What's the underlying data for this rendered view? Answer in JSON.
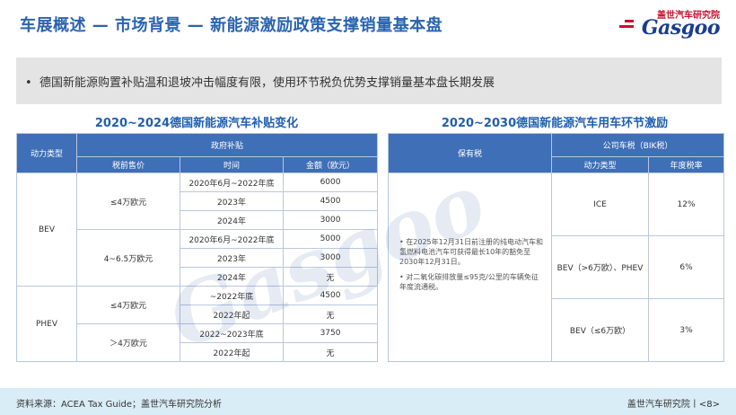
{
  "header": {
    "title": "车展概述 — 市场背景 — 新能源激励政策支撑销量基本盘",
    "logo_cn": "盖世汽车研究院",
    "logo_en": "Gasgoo"
  },
  "banner": {
    "bullet": "•",
    "text": "德国新能源购置补贴温和退坡冲击幅度有限，使用环节税负优势支撑销量基本盘长期发展"
  },
  "left_table": {
    "title": "2020~2024德国新能源汽车补贴变化",
    "headers": {
      "power_type": "动力类型",
      "gov_subsidy": "政府补贴",
      "price": "税前售价",
      "time": "时间",
      "amount": "金额（欧元）"
    },
    "groups": [
      {
        "type": "BEV",
        "bands": [
          {
            "price": "≤4万欧元",
            "rows": [
              {
                "time": "2020年6月~2022年底",
                "amount": "6000"
              },
              {
                "time": "2023年",
                "amount": "4500"
              },
              {
                "time": "2024年",
                "amount": "3000"
              }
            ]
          },
          {
            "price": "4~6.5万欧元",
            "rows": [
              {
                "time": "2020年6月~2022年底",
                "amount": "5000"
              },
              {
                "time": "2023年",
                "amount": "3000"
              },
              {
                "time": "2024年",
                "amount": "无"
              }
            ]
          }
        ]
      },
      {
        "type": "PHEV",
        "bands": [
          {
            "price": "≤4万欧元",
            "rows": [
              {
                "time": "~2022年底",
                "amount": "4500"
              },
              {
                "time": "2022年起",
                "amount": "无"
              }
            ]
          },
          {
            "price": "＞4万欧元",
            "rows": [
              {
                "time": "2022~2023年底",
                "amount": "3750"
              },
              {
                "time": "2022年起",
                "amount": "无"
              }
            ]
          }
        ]
      }
    ]
  },
  "right_table": {
    "title": "2020~2030德国新能源汽车用车环节激励",
    "headers": {
      "vehicle_tax": "保有税",
      "company_car_tax": "公司车税（BIK税）",
      "power_type": "动力类型",
      "annual_rate": "年度税率"
    },
    "notes": [
      "在2025年12月31日前注册的纯电动汽车和氢燃料电池汽车可获得最长10年的豁免至2030年12月31日。",
      "对二氧化碳排放量≤95克/公里的车辆免征年度流通税。"
    ],
    "note_bullet": "•",
    "rows": [
      {
        "type": "ICE",
        "rate": "12%"
      },
      {
        "type": "BEV（>6万欧）、PHEV",
        "rate": "6%"
      },
      {
        "type": "BEV（≤6万欧）",
        "rate": "3%"
      }
    ]
  },
  "footer": {
    "source": "资料来源：ACEA Tax Guide；盖世汽车研究院分析",
    "page": "盖世汽车研究院丨<8>"
  },
  "colors": {
    "title_blue": "#2a64b0",
    "header_blue": "#3f6fb6",
    "banner_gray": "#e4e4e4",
    "footer_blue": "#d9edf7",
    "brand_red": "#c8102e"
  }
}
